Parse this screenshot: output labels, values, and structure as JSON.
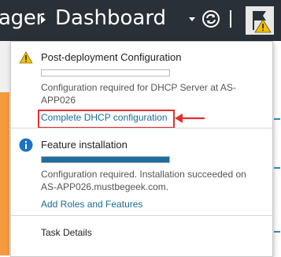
{
  "titlebar": {
    "app_fragment": "ager",
    "page": "Dashboard"
  },
  "notifications": [
    {
      "title": "Post-deployment Configuration",
      "icon": "warning-icon",
      "progress": 0.0,
      "message": "Configuration required for DHCP Server at AS-APP026",
      "link": "Complete DHCP configuration"
    },
    {
      "title": "Feature installation",
      "icon": "info-icon",
      "progress": 1.0,
      "message": "Configuration required. Installation succeeded on AS-APP026.mustbegeek.com.",
      "link": "Add Roles and Features"
    }
  ],
  "footer": {
    "task_details": "Task Details"
  },
  "colors": {
    "titlebar_bg": "#2a3037",
    "link": "#1b6b98",
    "progress_fill": "#1e6e9e",
    "highlight": "#e03030",
    "warning": "#f2c200",
    "info": "#1a73c5"
  }
}
